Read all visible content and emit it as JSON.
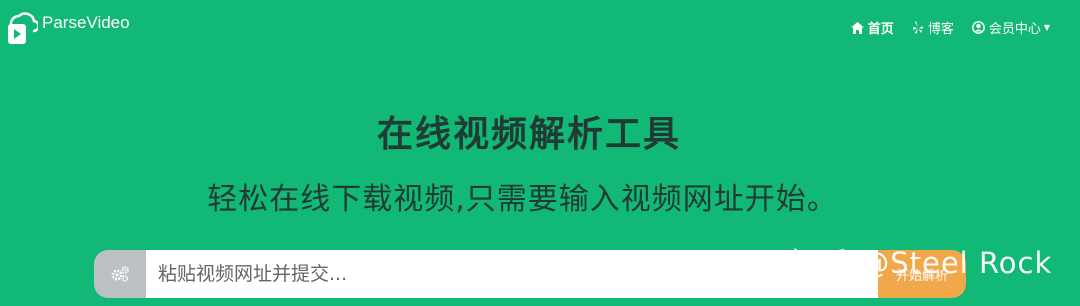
{
  "brand": {
    "name": "ParseVideo",
    "logo_icon": "video-cloud-logo-icon"
  },
  "nav": {
    "home": {
      "label": "首页",
      "icon": "home-icon"
    },
    "blog": {
      "label": "博客",
      "icon": "yelp-icon"
    },
    "member": {
      "label": "会员中心",
      "icon": "user-circle-icon",
      "caret": "▼"
    }
  },
  "hero": {
    "title": "在线视频解析工具",
    "subtitle": "轻松在线下载视频,只需要输入视频网址开始。"
  },
  "search": {
    "addon_icon": "gears-icon",
    "placeholder": "粘贴视频网址并提交...",
    "value": "",
    "button_label": "开始解析"
  },
  "watermark": {
    "text": "知乎 @Steel Rock"
  },
  "colors": {
    "background": "#12b876",
    "title_text": "#1f3b33",
    "button": "#f0a84a",
    "addon": "#bcc0c5"
  }
}
